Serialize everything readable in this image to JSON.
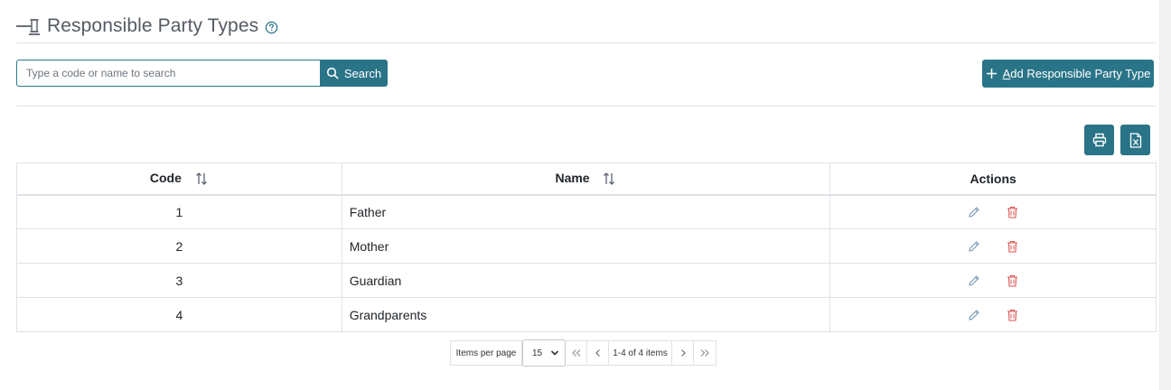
{
  "header": {
    "title": "Responsible Party Types",
    "title_icon": "gavel-icon",
    "help_icon": "question-circle-icon"
  },
  "search": {
    "placeholder": "Type a code or name to search",
    "value": "",
    "button_label": "Search"
  },
  "toolbar": {
    "add_label": "Add Responsible Party Type",
    "print_icon": "printer-icon",
    "export_icon": "excel-file-icon"
  },
  "table": {
    "columns": [
      {
        "label": "Code",
        "sortable": true
      },
      {
        "label": "Name",
        "sortable": true
      },
      {
        "label": "Actions",
        "sortable": false
      }
    ],
    "rows": [
      {
        "code": "1",
        "name": "Father"
      },
      {
        "code": "2",
        "name": "Mother"
      },
      {
        "code": "3",
        "name": "Guardian"
      },
      {
        "code": "4",
        "name": "Grandparents"
      }
    ]
  },
  "pager": {
    "items_per_page_label": "Items per page",
    "page_size": "15",
    "range_text": "1-4 of 4 items"
  },
  "colors": {
    "accent": "#2a7488",
    "edit_icon": "#7a9bb8",
    "delete_icon": "#d9534f",
    "border": "#dee2e6"
  }
}
